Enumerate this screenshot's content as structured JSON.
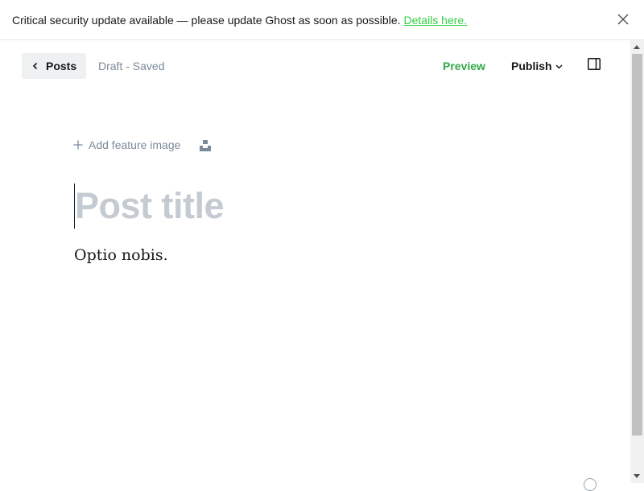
{
  "alert": {
    "message": "Critical security update available — please update Ghost as soon as possible.",
    "link_text": "Details here.",
    "close_icon": "close-icon"
  },
  "header": {
    "back_label": "Posts",
    "status": "Draft - Saved",
    "preview_label": "Preview",
    "publish_label": "Publish",
    "sidebar_icon": "sidebar-toggle-icon"
  },
  "editor": {
    "feature_image_label": "Add feature image",
    "title_placeholder": "Post title",
    "body_text": "Optio nobis."
  },
  "colors": {
    "accent_green": "#30cf43",
    "muted_text": "#7c8b9a",
    "placeholder": "#c5cbd2"
  }
}
